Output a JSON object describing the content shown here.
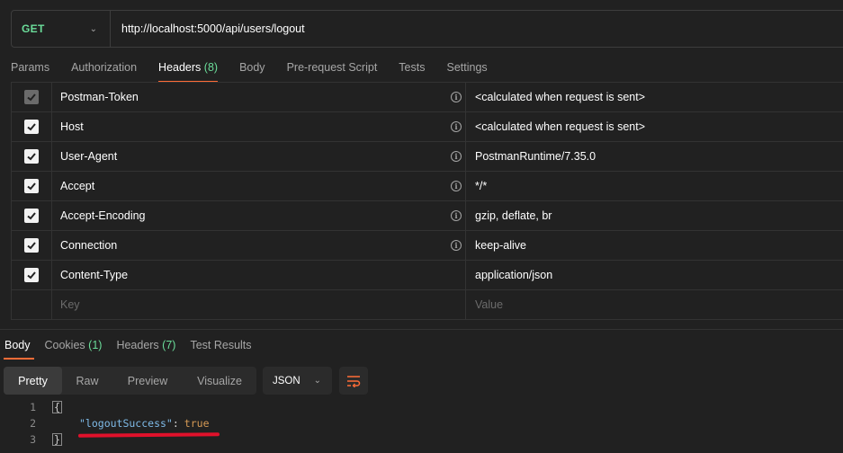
{
  "request": {
    "method": "GET",
    "url": "http://localhost:5000/api/users/logout"
  },
  "request_tabs": [
    {
      "label": "Params"
    },
    {
      "label": "Authorization"
    },
    {
      "label": "Headers",
      "count": "(8)"
    },
    {
      "label": "Body"
    },
    {
      "label": "Pre-request Script"
    },
    {
      "label": "Tests"
    },
    {
      "label": "Settings"
    }
  ],
  "headers": [
    {
      "key": "Postman-Token",
      "value": "<calculated when request is sent>",
      "checked": true,
      "locked": true,
      "info": true
    },
    {
      "key": "Host",
      "value": "<calculated when request is sent>",
      "checked": true,
      "info": true
    },
    {
      "key": "User-Agent",
      "value": "PostmanRuntime/7.35.0",
      "checked": true,
      "info": true
    },
    {
      "key": "Accept",
      "value": "*/*",
      "checked": true,
      "info": true
    },
    {
      "key": "Accept-Encoding",
      "value": "gzip, deflate, br",
      "checked": true,
      "info": true
    },
    {
      "key": "Connection",
      "value": "keep-alive",
      "checked": true,
      "info": true
    },
    {
      "key": "Content-Type",
      "value": "application/json",
      "checked": true,
      "info": false
    }
  ],
  "new_header": {
    "key_placeholder": "Key",
    "value_placeholder": "Value"
  },
  "response_tabs": [
    {
      "label": "Body"
    },
    {
      "label": "Cookies",
      "count": "(1)"
    },
    {
      "label": "Headers",
      "count": "(7)"
    },
    {
      "label": "Test Results"
    }
  ],
  "view_modes": [
    "Pretty",
    "Raw",
    "Preview",
    "Visualize"
  ],
  "format": "JSON",
  "code": {
    "line_numbers": [
      "1",
      "2",
      "3"
    ],
    "open_brace": "{",
    "close_brace": "}",
    "key": "\"logoutSuccess\"",
    "colon": ":",
    "value": "true"
  },
  "colors": {
    "accent": "#ff6c37",
    "method": "#6bdd9a",
    "highlight": "#e0112b"
  }
}
